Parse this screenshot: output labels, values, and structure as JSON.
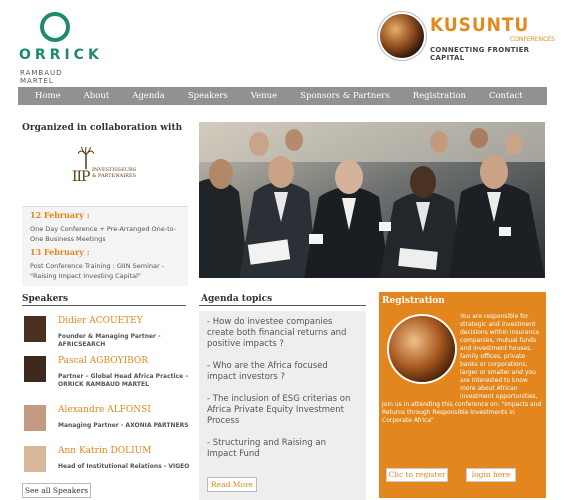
{
  "header": {
    "orrick": {
      "name": "ORRICK",
      "sub": "RAMBAUD MARTEL"
    },
    "kusuntu": {
      "word": "KUSUNTU",
      "conferences": "CONFERENCES",
      "tagline": "CONNECTING FRONTIER CAPITAL"
    }
  },
  "nav": {
    "items": [
      "Home",
      "About",
      "Agenda",
      "Speakers",
      "Venue",
      "Sponsors & Partners",
      "Registration",
      "Contact"
    ]
  },
  "collaboration": {
    "title": "Organized in collaboration with",
    "logo_text": "IIP",
    "logo_sub": "INVESTISSEURS & PARTENAIRES"
  },
  "events": [
    {
      "date": "12 February :",
      "desc": "One Day Conference + Pre-Arranged One-to-One Business Meetings"
    },
    {
      "date": "13 February :",
      "desc": "Post Conference Training : GIIN Seminar - \"Raising Impact Investing Capital\""
    }
  ],
  "speakers": {
    "title": "Speakers",
    "list": [
      {
        "name": "Didier ACOUETEY",
        "role": "Founder & Managing Partner - AFRICSEARCH"
      },
      {
        "name": "Pascal AGBOYIBOR",
        "role": "Partner – Global Head Africa Practice – ORRICK RAMBAUD MARTEL"
      },
      {
        "name": "Alexandre ALFONSI",
        "role": "Managing Partner - AXONIA PARTNERS"
      },
      {
        "name": "Ann Katrin DOLIUM",
        "role": "Head of Institutional Relations - VIGEO"
      }
    ],
    "see_all": "See all Speakers"
  },
  "agenda": {
    "title": "Agenda topics",
    "items": [
      "- How do investee companies create both financial returns and positive impacts ?",
      "- Who are the Africa focused impact investors ?",
      "- The inclusion of ESG criterias on Africa Private Equity Investment Process",
      "- Structuring and Raising an Impact Fund"
    ],
    "read_more": "Read More"
  },
  "registration": {
    "title": "Registration",
    "text": "You are responsible for strategic and investment decisions within insurance companies, mutual funds and investment houses, family offices, private banks or corporations, larger or smaller and you are interested to know more about African investment opportunities, Join us in attending this conference on: \"Impacts and Returns through Responsible Investments in Corporate Africa\"",
    "register_button": "Clic to register",
    "login_button": "login here"
  },
  "colors": {
    "accent": "#e3861d",
    "nav_bg": "#8f9194",
    "orrick_green": "#1e8a6e"
  }
}
